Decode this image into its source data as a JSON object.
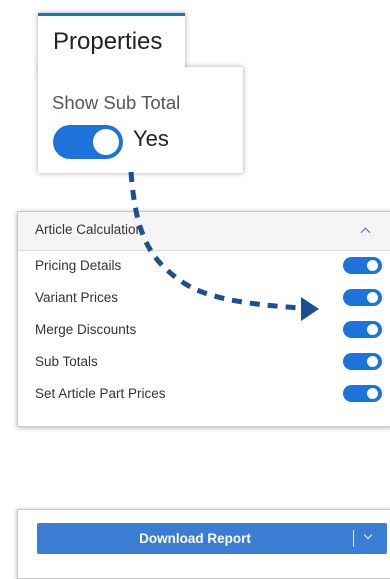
{
  "properties": {
    "tab_title": "Properties",
    "field_label": "Show Sub Total",
    "toggle_state": true,
    "toggle_value": "Yes"
  },
  "article_calculation": {
    "title": "Article Calculation",
    "rows": [
      {
        "label": "Pricing Details",
        "enabled": true
      },
      {
        "label": "Variant Prices",
        "enabled": true
      },
      {
        "label": "Merge Discounts",
        "enabled": true
      },
      {
        "label": "Sub Totals",
        "enabled": true
      },
      {
        "label": "Set Article Part Prices",
        "enabled": true
      }
    ]
  },
  "download": {
    "button_label": "Download Report"
  },
  "colors": {
    "accent_blue": "#1e73d8",
    "button_blue": "#3b7dd3",
    "arrow_navy": "#1f4f8c"
  },
  "icons": {
    "collapse": "chevron-up-icon",
    "dropdown": "chevron-down-icon"
  }
}
